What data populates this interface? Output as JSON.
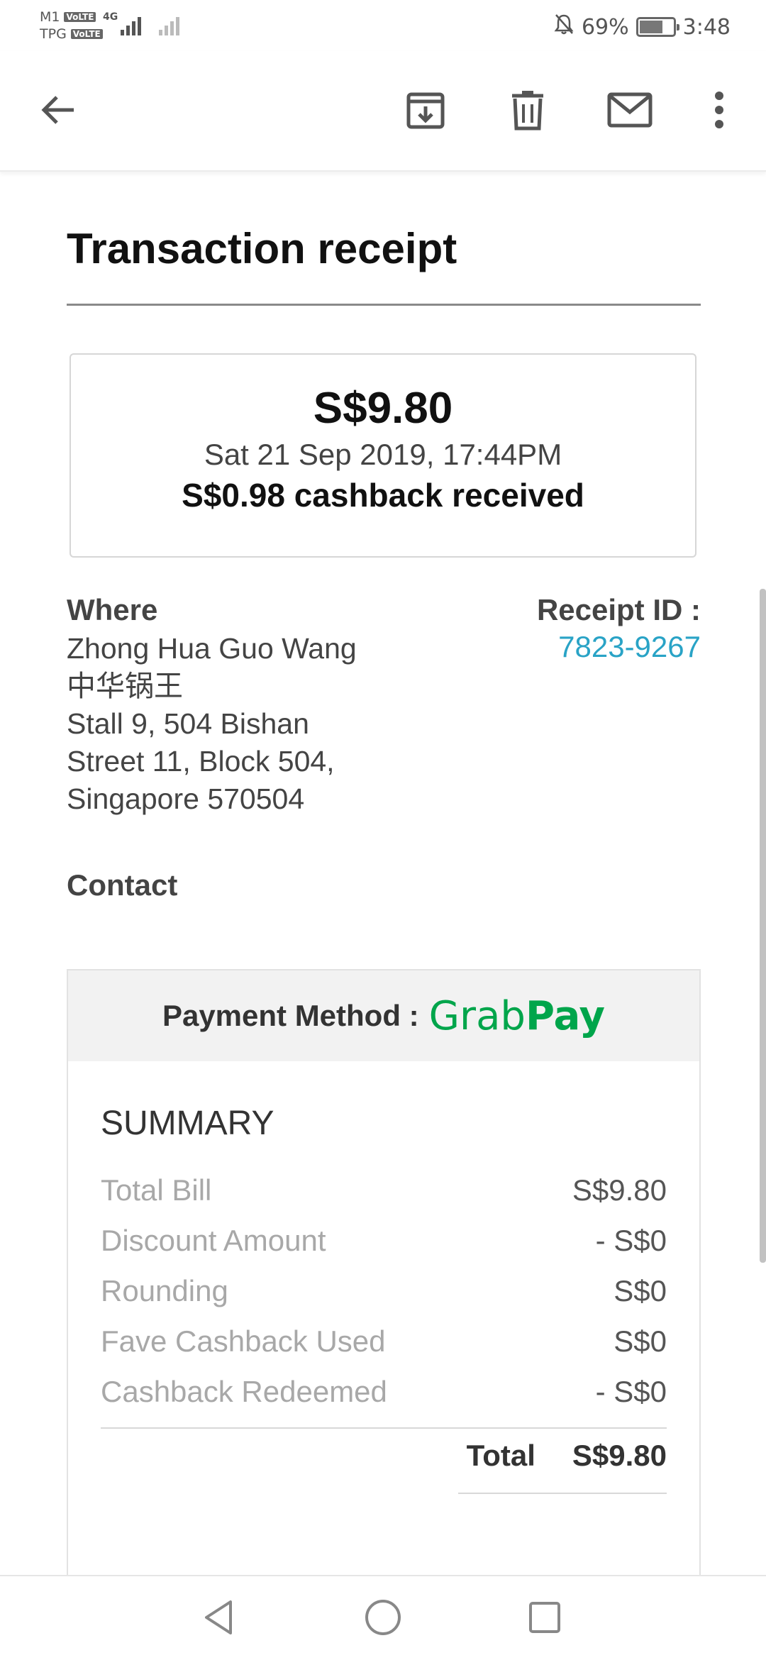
{
  "status_bar": {
    "carrier1": "M1",
    "carrier2": "TPG",
    "volte": "VoLTE",
    "network": "4G",
    "battery_percent": "69%",
    "battery_level": 0.69,
    "time": "3:48",
    "icons": [
      "signal-icon",
      "mute-bell-icon",
      "battery-icon"
    ]
  },
  "toolbar": {
    "icons": [
      "back-arrow-icon",
      "archive-icon",
      "trash-icon",
      "mail-icon",
      "more-vert-icon"
    ]
  },
  "receipt": {
    "title": "Transaction receipt",
    "amount": "S$9.80",
    "datetime": "Sat 21 Sep 2019, 17:44PM",
    "cashback": "S$0.98 cashback received",
    "where_label": "Where",
    "merchant_lines": [
      "Zhong Hua Guo Wang",
      "中华锅王",
      "Stall 9, 504 Bishan",
      "Street 11, Block 504,",
      "Singapore 570504"
    ],
    "receipt_id_label": "Receipt ID :",
    "receipt_id": "7823-9267",
    "contact_label": "Contact",
    "payment_label": "Payment Method :",
    "payment_brand_part1": "Grab",
    "payment_brand_part2": "Pay",
    "summary_title": "SUMMARY",
    "summary_rows": [
      {
        "label": "Total Bill",
        "value": "S$9.80"
      },
      {
        "label": "Discount Amount",
        "value": "- S$0"
      },
      {
        "label": "Rounding",
        "value": "S$0"
      },
      {
        "label": "Fave Cashback Used",
        "value": "S$0"
      },
      {
        "label": "Cashback Redeemed",
        "value": "- S$0"
      }
    ],
    "total_label": "Total",
    "total_value": "S$9.80"
  },
  "colors": {
    "link": "#29a3c6",
    "grab_green": "#00a54b"
  },
  "nav_bar": {
    "icons": [
      "back-triangle-icon",
      "home-circle-icon",
      "recents-square-icon"
    ]
  }
}
